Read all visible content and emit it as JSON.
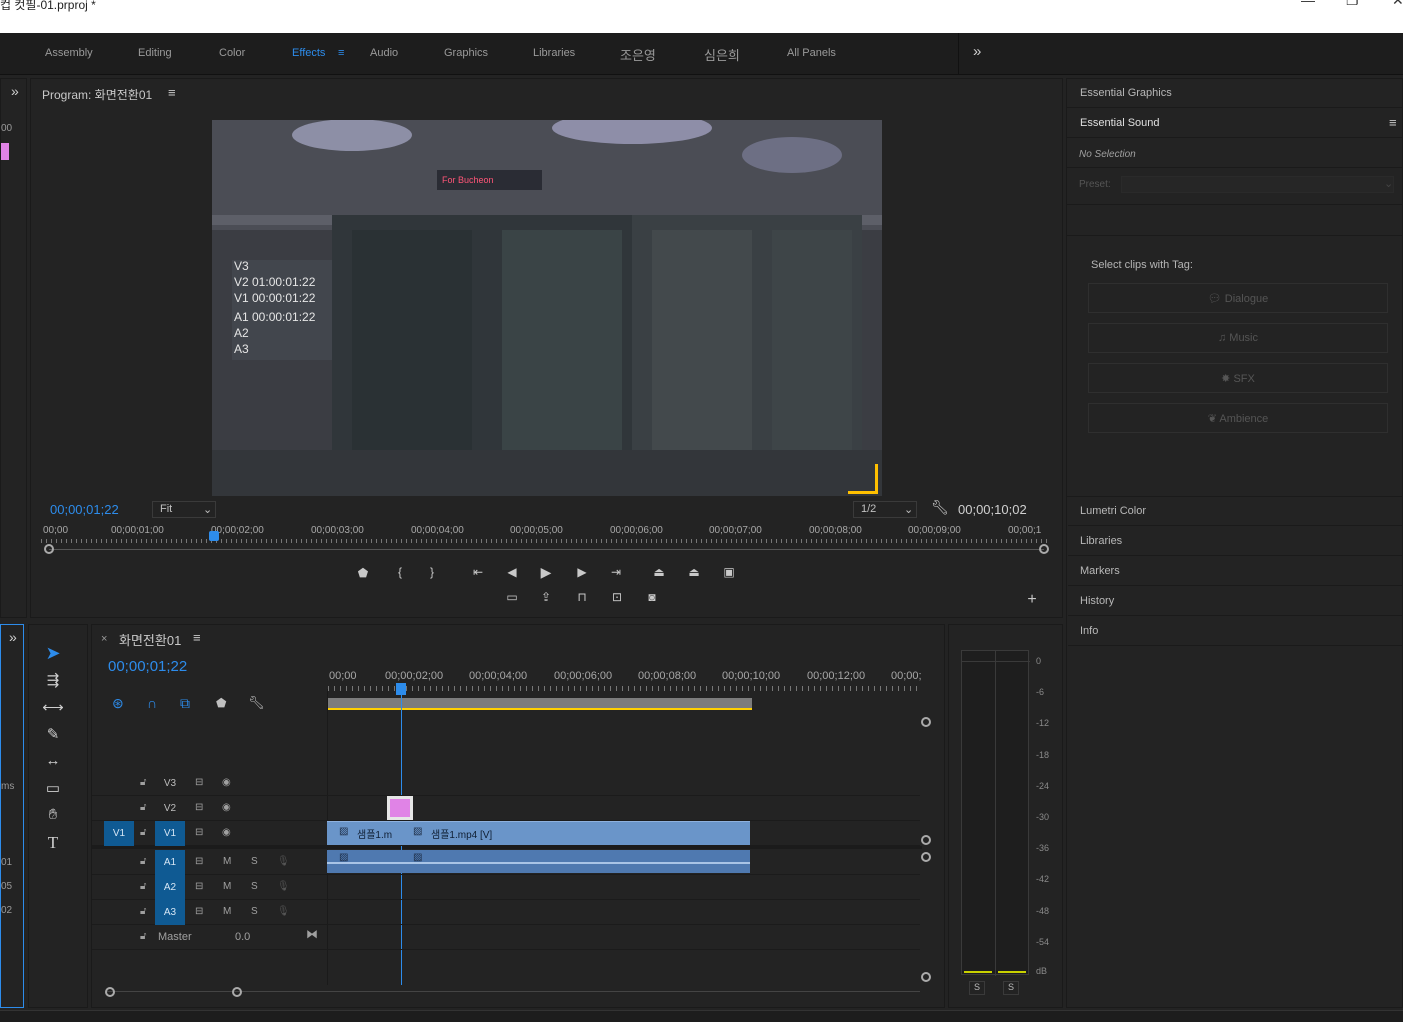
{
  "window": {
    "title": "컵 컷필-01.prproj *",
    "minimize": "—",
    "restore": "❐",
    "close": "✕"
  },
  "workspaces": {
    "tabs": [
      {
        "label": "Assembly"
      },
      {
        "label": "Editing"
      },
      {
        "label": "Color"
      },
      {
        "label": "Effects"
      },
      {
        "label": "Audio"
      },
      {
        "label": "Graphics"
      },
      {
        "label": "Libraries"
      },
      {
        "label": "조은영"
      },
      {
        "label": "심은희"
      },
      {
        "label": "All Panels"
      }
    ],
    "active": "Effects",
    "more": "»"
  },
  "program": {
    "title": "Program: 화면전환01",
    "menu": "≡",
    "overlay": [
      "V3",
      "V2 01:00:01:22",
      "V1 00:00:01:22",
      "A1 00:00:01:22",
      "A2",
      "A3"
    ],
    "sign_text": "For Bucheon",
    "timecode": "00;00;01;22",
    "fit": "Fit",
    "resolution": "1/2",
    "duration": "00;00;10;02",
    "ruler": [
      "00;00",
      "00;00;01;00",
      "00;00;02;00",
      "00;00;03;00",
      "00;00;04;00",
      "00;00;05;00",
      "00;00;06;00",
      "00;00;07;00",
      "00;00;08;00",
      "00;00;09;00",
      "00;00;1"
    ],
    "add": "+"
  },
  "right_panel": {
    "essential_graphics": "Essential Graphics",
    "essential_sound": "Essential Sound",
    "no_selection": "No Selection",
    "preset_label": "Preset:",
    "select_tag": "Select clips with Tag:",
    "tags": [
      {
        "label": "Dialogue",
        "icon": "speech-icon"
      },
      {
        "label": "Music",
        "icon": "note-icon"
      },
      {
        "label": "SFX",
        "icon": "burst-icon"
      },
      {
        "label": "Ambience",
        "icon": "leaf-icon"
      }
    ],
    "collapsed": [
      "Lumetri Color",
      "Libraries",
      "Markers",
      "History",
      "Info"
    ]
  },
  "timeline": {
    "close": "×",
    "title": "화면전환01",
    "menu": "≡",
    "timecode": "00;00;01;22",
    "ruler": [
      "00;00",
      "00;00;02;00",
      "00;00;04;00",
      "00;00;06;00",
      "00;00;08;00",
      "00;00;10;00",
      "00;00;12;00",
      "00;00;"
    ],
    "video_tracks": [
      {
        "name": "V3"
      },
      {
        "name": "V2"
      },
      {
        "name": "V1",
        "source": "V1"
      }
    ],
    "audio_tracks": [
      {
        "name": "A1"
      },
      {
        "name": "A2"
      },
      {
        "name": "A3"
      }
    ],
    "master_label": "Master",
    "master_value": "0.0",
    "clip1": "샘플1.m",
    "clip2": "샘플1.mp4 [V]",
    "m": "M",
    "s": "S"
  },
  "meter": {
    "scale": [
      "0",
      "-6",
      "-12",
      "-18",
      "-24",
      "-30",
      "-36",
      "-42",
      "-48",
      "-54",
      "dB"
    ],
    "solo": "S"
  },
  "left_edge": {
    "labels": [
      "00",
      "ms",
      "01",
      "05",
      "02"
    ]
  },
  "colors": {
    "accent": "#2d8ceb",
    "clip_video": "#6a95c9",
    "clip_audio": "#4f79b0",
    "v2_clip": "#e083e6",
    "track_active": "#0f5a93",
    "workarea": "#ffd000"
  }
}
